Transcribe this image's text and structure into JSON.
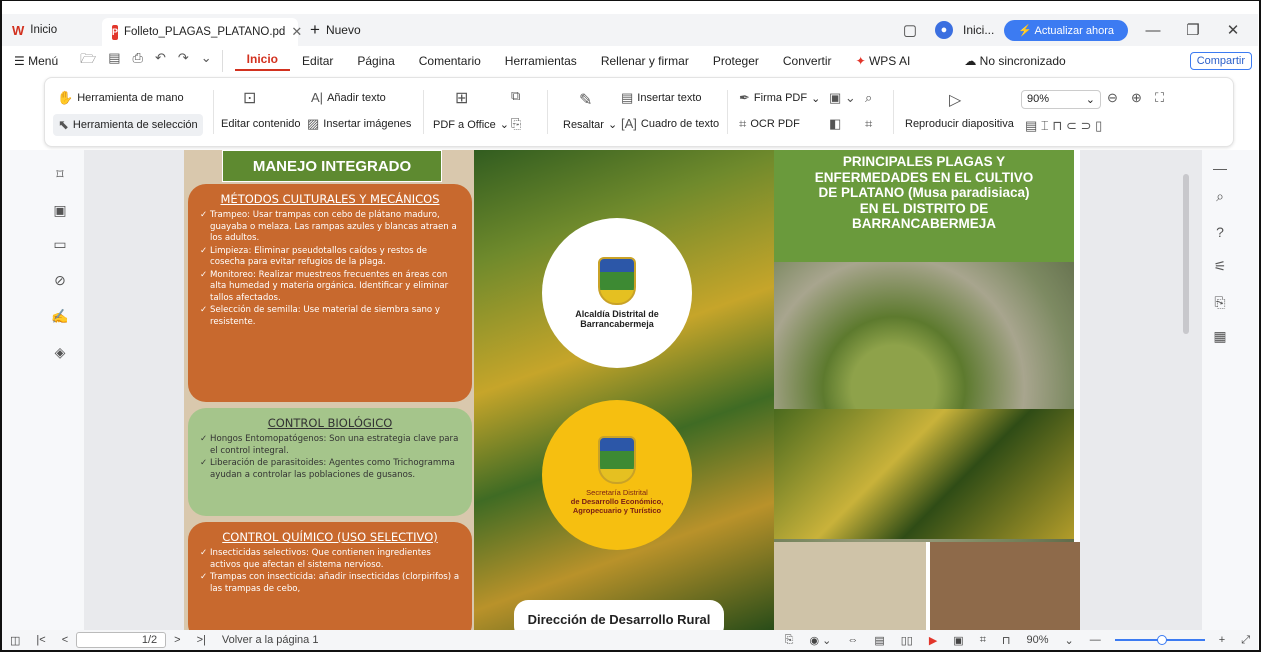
{
  "titlebar": {
    "home_tab": "Inicio",
    "doc_tab": "Folleto_PLAGAS_PLATANO.pd",
    "new_tab": "Nuevo",
    "account": "Inici...",
    "update_button": "Actualizar ahora"
  },
  "menubar": {
    "menu": "Menú",
    "tabs": [
      "Inicio",
      "Editar",
      "Página",
      "Comentario",
      "Herramientas",
      "Rellenar y firmar",
      "Proteger",
      "Convertir",
      "WPS AI"
    ],
    "sync": "No sincronizado",
    "share": "Compartir"
  },
  "ribbon": {
    "hand_tool": "Herramienta de mano",
    "select_tool": "Herramienta de selección",
    "edit_content": "Editar contenido",
    "add_text": "Añadir texto",
    "insert_images": "Insertar imágenes",
    "pdf_to_office": "PDF a Office",
    "highlight": "Resaltar",
    "insert_text": "Insertar texto",
    "text_box": "Cuadro de texto",
    "sign_pdf": "Firma PDF",
    "ocr_pdf": "OCR PDF",
    "slideshow": "Reproducir diapositiva",
    "zoom": "90%"
  },
  "document": {
    "col1": {
      "banner": "MANEJO INTEGRADO",
      "box1_title": "MÉTODOS CULTURALES Y MECÁNICOS",
      "box1_items": [
        "Trampeo: Usar trampas con cebo de plátano maduro, guayaba o melaza. Las rampas azules y blancas atraen a los adultos.",
        "Limpieza: Eliminar pseudotallos caídos y restos de cosecha para evitar refugios de la plaga.",
        "Monitoreo: Realizar muestreos frecuentes en áreas con alta humedad y materia orgánica. Identificar y eliminar tallos afectados.",
        "Selección de semilla: Use material de siembra sano y resistente."
      ],
      "box2_title": "CONTROL BIOLÓGICO",
      "box2_items": [
        "Hongos Entomopatógenos: Son una estrategia clave para el control integral.",
        "Liberación de parasitoides: Agentes como Trichogramma ayudan a controlar las poblaciones de gusanos."
      ],
      "box3_title": "CONTROL QUÍMICO (USO SELECTIVO)",
      "box3_items": [
        "Insecticidas selectivos: Que contienen ingredientes activos que afectan el sistema nervioso.",
        "Trampas con insecticida: añadir insecticidas (clorpirifos) a las trampas de cebo,"
      ]
    },
    "col2": {
      "logo1_line1": "Alcaldía Distrital de",
      "logo1_line2": "Barrancabermeja",
      "logo2_line1": "Secretaría Distrital",
      "logo2_line2": "de Desarrollo Económico,",
      "logo2_line3": "Agropecuario y Turístico",
      "bottom_label": "Dirección de Desarrollo Rural"
    },
    "col3": {
      "title_line1": "PRINCIPALES PLAGAS Y",
      "title_line2": "ENFERMEDADES EN EL CULTIVO",
      "title_line3": "DE PLATANO (Musa paradisiaca)",
      "title_line4": "EN EL DISTRITO DE",
      "title_line5": "BARRANCABERMEJA"
    }
  },
  "statusbar": {
    "page": "1/2",
    "back_to_page": "Volver a la página 1",
    "zoom": "90%"
  },
  "colors": {
    "accent": "#d2311f",
    "update": "#3c7bf2",
    "green_title": "#6a9a3c",
    "orange_box": "#c8692e"
  }
}
